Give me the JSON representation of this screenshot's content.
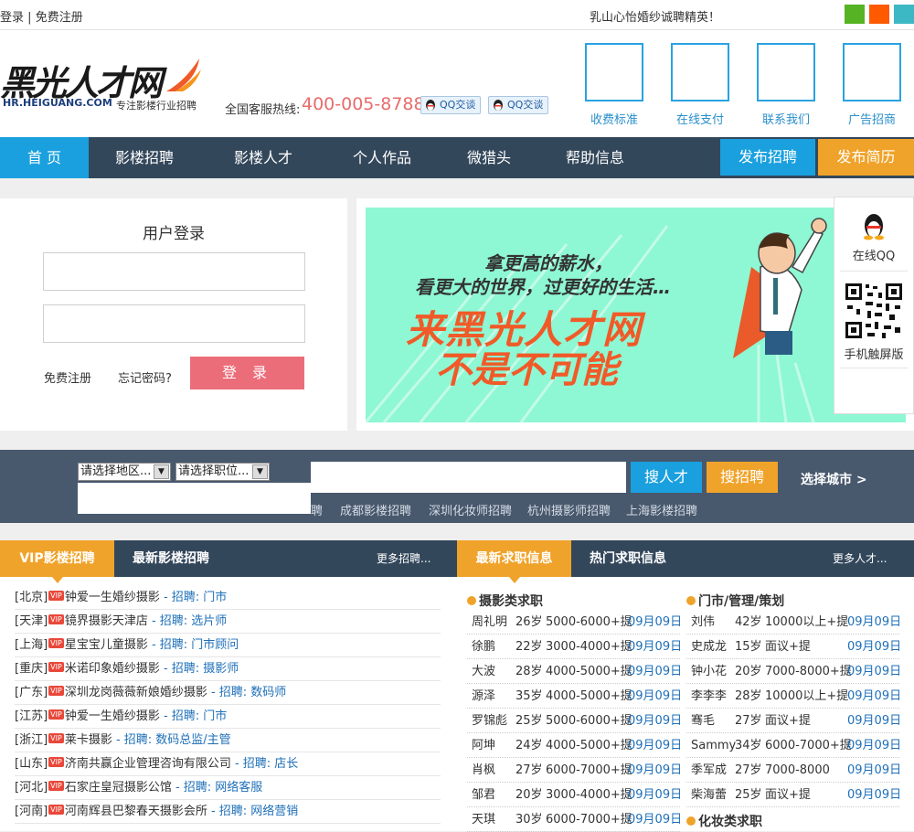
{
  "topbar": {
    "login": "登录",
    "sep": "|",
    "register": "免费注册",
    "notice": "乳山心怡婚纱诚聘精英！",
    "swatches": [
      "#56b323",
      "#ff5a00",
      "#3cb8c4"
    ]
  },
  "header": {
    "logo_text": "黑光人才网",
    "logo_domain": "HR.HEIGUANG.COM",
    "logo_slogan": "专注影楼行业招聘",
    "hotline_label": "全国客服热线:",
    "hotline_number": "400-005-8788",
    "qq_buttons": [
      "QQ交谈",
      "QQ交谈"
    ],
    "quick_links": [
      "收费标准",
      "在线支付",
      "联系我们",
      "广告招商"
    ]
  },
  "nav": {
    "items": [
      "首 页",
      "影楼招聘",
      "影楼人才",
      "个人作品",
      "微猎头",
      "帮助信息"
    ],
    "post_job": "发布招聘",
    "post_resume": "发布简历"
  },
  "login": {
    "title": "用户登录",
    "register_link": "免费注册",
    "forgot_link": "忘记密码?",
    "submit": "登 录"
  },
  "banner": {
    "line1": "拿更高的薪水，",
    "line2": "看更大的世界，过更好的生活…",
    "big1": "来黑光人才网",
    "big2": "不是不可能"
  },
  "sidefloat": {
    "qq_label": "在线QQ",
    "mobile_label": "手机触屏版"
  },
  "search": {
    "region_select": "请选择地区...",
    "position_select": "请选择职位...",
    "btn_talent": "搜人才",
    "btn_jobs": "搜招聘",
    "city_select": "选择城市 >",
    "hot_links": [
      "聘",
      "成都影楼招聘",
      "深圳化妆师招聘",
      "杭州摄影师招聘",
      "上海影楼招聘"
    ]
  },
  "vip_panel": {
    "tab_active": "VIP影楼招聘",
    "tab_other": "最新影楼招聘",
    "more": "更多招聘...",
    "badge": "VIP",
    "job_prefix": " - 招聘: ",
    "rows": [
      {
        "region": "[北京]",
        "company": "钟爱一生婚纱摄影",
        "job": "门市"
      },
      {
        "region": "[天津]",
        "company": "镜界摄影天津店",
        "job": "选片师"
      },
      {
        "region": "[上海]",
        "company": "星宝宝儿童摄影",
        "job": "门市顾问"
      },
      {
        "region": "[重庆]",
        "company": "米诺印象婚纱摄影",
        "job": "摄影师"
      },
      {
        "region": "[广东]",
        "company": "深圳龙岗薇薇新娘婚纱摄影",
        "job": "数码师"
      },
      {
        "region": "[江苏]",
        "company": "钟爱一生婚纱摄影",
        "job": "门市"
      },
      {
        "region": "[浙江]",
        "company": "莱卡摄影",
        "job": "数码总监/主管"
      },
      {
        "region": "[山东]",
        "company": "济南共赢企业管理咨询有限公司",
        "job": "店长"
      },
      {
        "region": "[河北]",
        "company": "石家庄皇冠摄影公馆",
        "job": "网络客服"
      },
      {
        "region": "[河南]",
        "company": "河南辉县巴黎春天摄影会所",
        "job": "网络营销"
      }
    ]
  },
  "seek_panel": {
    "tab_active": "最新求职信息",
    "tab_other": "热门求职信息",
    "more": "更多人才...",
    "col1_title": "摄影类求职",
    "col2_title": "门市/管理/策划",
    "col3_title": "化妆类求职",
    "col1_rows": [
      {
        "name": "周礼明",
        "age": "26岁",
        "salary": "5000-6000+提",
        "date": "09月09日"
      },
      {
        "name": "徐鹏",
        "age": "22岁",
        "salary": "3000-4000+提",
        "date": "09月09日"
      },
      {
        "name": "大波",
        "age": "28岁",
        "salary": "4000-5000+提",
        "date": "09月09日"
      },
      {
        "name": "源泽",
        "age": "35岁",
        "salary": "4000-5000+提",
        "date": "09月09日"
      },
      {
        "name": "罗锦彪",
        "age": "25岁",
        "salary": "5000-6000+提",
        "date": "09月09日"
      },
      {
        "name": "阿坤",
        "age": "24岁",
        "salary": "4000-5000+提",
        "date": "09月09日"
      },
      {
        "name": "肖枫",
        "age": "27岁",
        "salary": "6000-7000+提",
        "date": "09月09日"
      },
      {
        "name": "邹君",
        "age": "20岁",
        "salary": "3000-4000+提",
        "date": "09月09日"
      },
      {
        "name": "天琪",
        "age": "30岁",
        "salary": "6000-7000+提",
        "date": "09月09日"
      }
    ],
    "col2_rows": [
      {
        "name": "刘伟",
        "age": "42岁",
        "salary": "10000以上+提",
        "date": "09月09日"
      },
      {
        "name": "史成龙",
        "age": "15岁",
        "salary": "面议+提",
        "date": "09月09日"
      },
      {
        "name": "钟小花",
        "age": "20岁",
        "salary": "7000-8000+提",
        "date": "09月09日"
      },
      {
        "name": "李李李",
        "age": "28岁",
        "salary": "10000以上+提",
        "date": "09月09日"
      },
      {
        "name": "骞毛",
        "age": "27岁",
        "salary": "面议+提",
        "date": "09月09日"
      },
      {
        "name": "Sammy",
        "age": "34岁",
        "salary": "6000-7000+提",
        "date": "09月09日"
      },
      {
        "name": "季军成",
        "age": "27岁",
        "salary": "7000-8000",
        "date": "09月09日"
      },
      {
        "name": "柴海蕾",
        "age": "25岁",
        "salary": "面议+提",
        "date": "09月09日"
      }
    ]
  }
}
